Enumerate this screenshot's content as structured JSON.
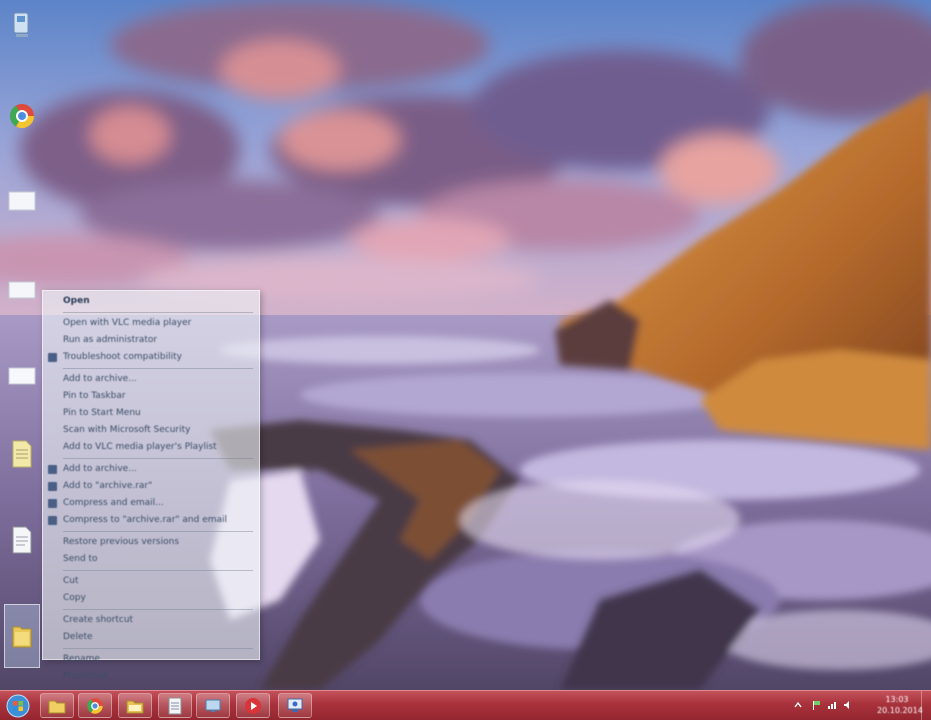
{
  "wallpaper": {
    "name": "coastal-sunset-wallpaper"
  },
  "desktop_icons": [
    {
      "name": "computer-icon"
    },
    {
      "name": "chrome-icon"
    },
    {
      "name": "folder-icon"
    },
    {
      "name": "document-icon"
    },
    {
      "name": "document-icon"
    },
    {
      "name": "notepad-file-icon"
    },
    {
      "name": "text-file-icon"
    },
    {
      "name": "user-folder-icon"
    }
  ],
  "context_menu": {
    "items": [
      {
        "label": "Open",
        "bold": true
      },
      {
        "label": "Open with VLC media player"
      },
      {
        "label": "Run as administrator"
      },
      {
        "label": "Troubleshoot compatibility",
        "icon": true
      },
      {
        "label": "Add to archive..."
      },
      {
        "label": "Pin to Taskbar"
      },
      {
        "label": "Pin to Start Menu"
      },
      {
        "label": "Scan with Microsoft Security"
      },
      {
        "label": "Add to VLC media player's Playlist"
      },
      {
        "label": "Add to archive...",
        "icon": true
      },
      {
        "label": "Add to \"archive.rar\"",
        "icon": true
      },
      {
        "label": "Compress and email...",
        "icon": true
      },
      {
        "label": "Compress to \"archive.rar\" and email",
        "icon": true
      },
      {
        "label": "Restore previous versions"
      },
      {
        "label": "Send to"
      },
      {
        "label": "Cut"
      },
      {
        "label": "Copy"
      },
      {
        "label": "Create shortcut"
      },
      {
        "label": "Delete"
      },
      {
        "label": "Rename"
      },
      {
        "label": "Properties"
      }
    ]
  },
  "taskbar": {
    "apps": [
      {
        "name": "explorer-icon"
      },
      {
        "name": "chrome-taskbar-icon"
      },
      {
        "name": "folder-taskbar-icon"
      },
      {
        "name": "notepad-taskbar-icon"
      },
      {
        "name": "network-taskbar-icon"
      },
      {
        "name": "media-player-taskbar-icon"
      },
      {
        "name": "remote-desktop-taskbar-icon"
      }
    ],
    "clock": {
      "time": "13:03",
      "date": "20.10.2014"
    }
  },
  "colors": {
    "taskbar": "#a8323c",
    "menu_text": "#3b4d66"
  }
}
